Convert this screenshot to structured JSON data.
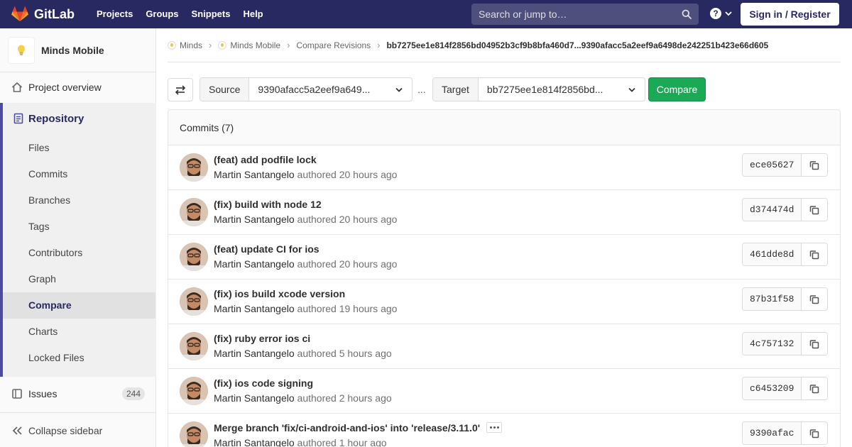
{
  "navbar": {
    "brand": "GitLab",
    "links": [
      "Projects",
      "Groups",
      "Snippets",
      "Help"
    ],
    "search_placeholder": "Search or jump to…",
    "help_icon": "?",
    "signin_label": "Sign in / Register",
    "bg_color": "#292961"
  },
  "sidebar": {
    "project_name": "Minds Mobile",
    "overview_label": "Project overview",
    "repository_label": "Repository",
    "repository_items": [
      "Files",
      "Commits",
      "Branches",
      "Tags",
      "Contributors",
      "Graph",
      "Compare",
      "Charts",
      "Locked Files"
    ],
    "active_item": "Compare",
    "issues_label": "Issues",
    "issues_count": "244",
    "collapse_label": "Collapse sidebar"
  },
  "breadcrumb": {
    "items": [
      "Minds",
      "Minds Mobile",
      "Compare Revisions"
    ],
    "current": "bb7275ee1e814f2856bd04952b3cf9b8bfa460d7...9390afacc5a2eef9a6498de242251b423e66d605"
  },
  "compare": {
    "source_label": "Source",
    "source_value": "9390afacc5a2eef9a649...",
    "separator": "...",
    "target_label": "Target",
    "target_value": "bb7275ee1e814f2856bd...",
    "button_label": "Compare",
    "button_color": "#1aaa55"
  },
  "commits": {
    "header": "Commits (7)",
    "rows": [
      {
        "title": "(feat) add podfile lock",
        "author": "Martin Santangelo",
        "authored": "authored",
        "time": "20 hours ago",
        "sha": "ece05627"
      },
      {
        "title": "(fix) build with node 12",
        "author": "Martin Santangelo",
        "authored": "authored",
        "time": "20 hours ago",
        "sha": "d374474d"
      },
      {
        "title": "(feat) update CI for ios",
        "author": "Martin Santangelo",
        "authored": "authored",
        "time": "20 hours ago",
        "sha": "461dde8d"
      },
      {
        "title": "(fix) ios build xcode version",
        "author": "Martin Santangelo",
        "authored": "authored",
        "time": "19 hours ago",
        "sha": "87b31f58"
      },
      {
        "title": "(fix) ruby error ios ci",
        "author": "Martin Santangelo",
        "authored": "authored",
        "time": "5 hours ago",
        "sha": "4c757132"
      },
      {
        "title": "(fix) ios code signing",
        "author": "Martin Santangelo",
        "authored": "authored",
        "time": "2 hours ago",
        "sha": "c6453209"
      },
      {
        "title": "Merge branch 'fix/ci-android-and-ios' into 'release/3.11.0'",
        "author": "Martin Santangelo",
        "authored": "authored",
        "time": "1 hour ago",
        "sha": "9390afac"
      }
    ]
  }
}
